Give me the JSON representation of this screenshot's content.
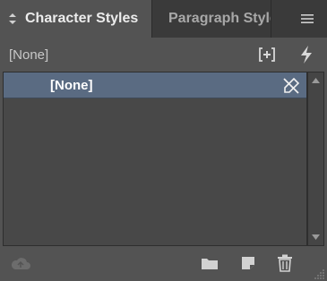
{
  "tabs": [
    {
      "label": "Character Styles",
      "active": true
    },
    {
      "label": "Paragraph Styles",
      "active": false
    }
  ],
  "panel_menu_icon": "hamburger-menu-icon",
  "current_style": "[None]",
  "toolbar_icons": {
    "create_style_group": "bracket-plus-icon",
    "quick_apply": "lightning-icon"
  },
  "list": {
    "items": [
      {
        "label": "[None]",
        "selected": true,
        "icon": "no-edit-pencil-icon"
      }
    ]
  },
  "bottom_icons": {
    "cloud": "cloud-sync-icon",
    "folder": "folder-icon",
    "new_style": "new-style-icon",
    "delete": "trash-icon"
  },
  "colors": {
    "panel_bg": "#535353",
    "tabbar_bg": "#3a3a3a",
    "list_bg": "#484848",
    "selection": "#5a6b82",
    "text": "#ececec"
  }
}
